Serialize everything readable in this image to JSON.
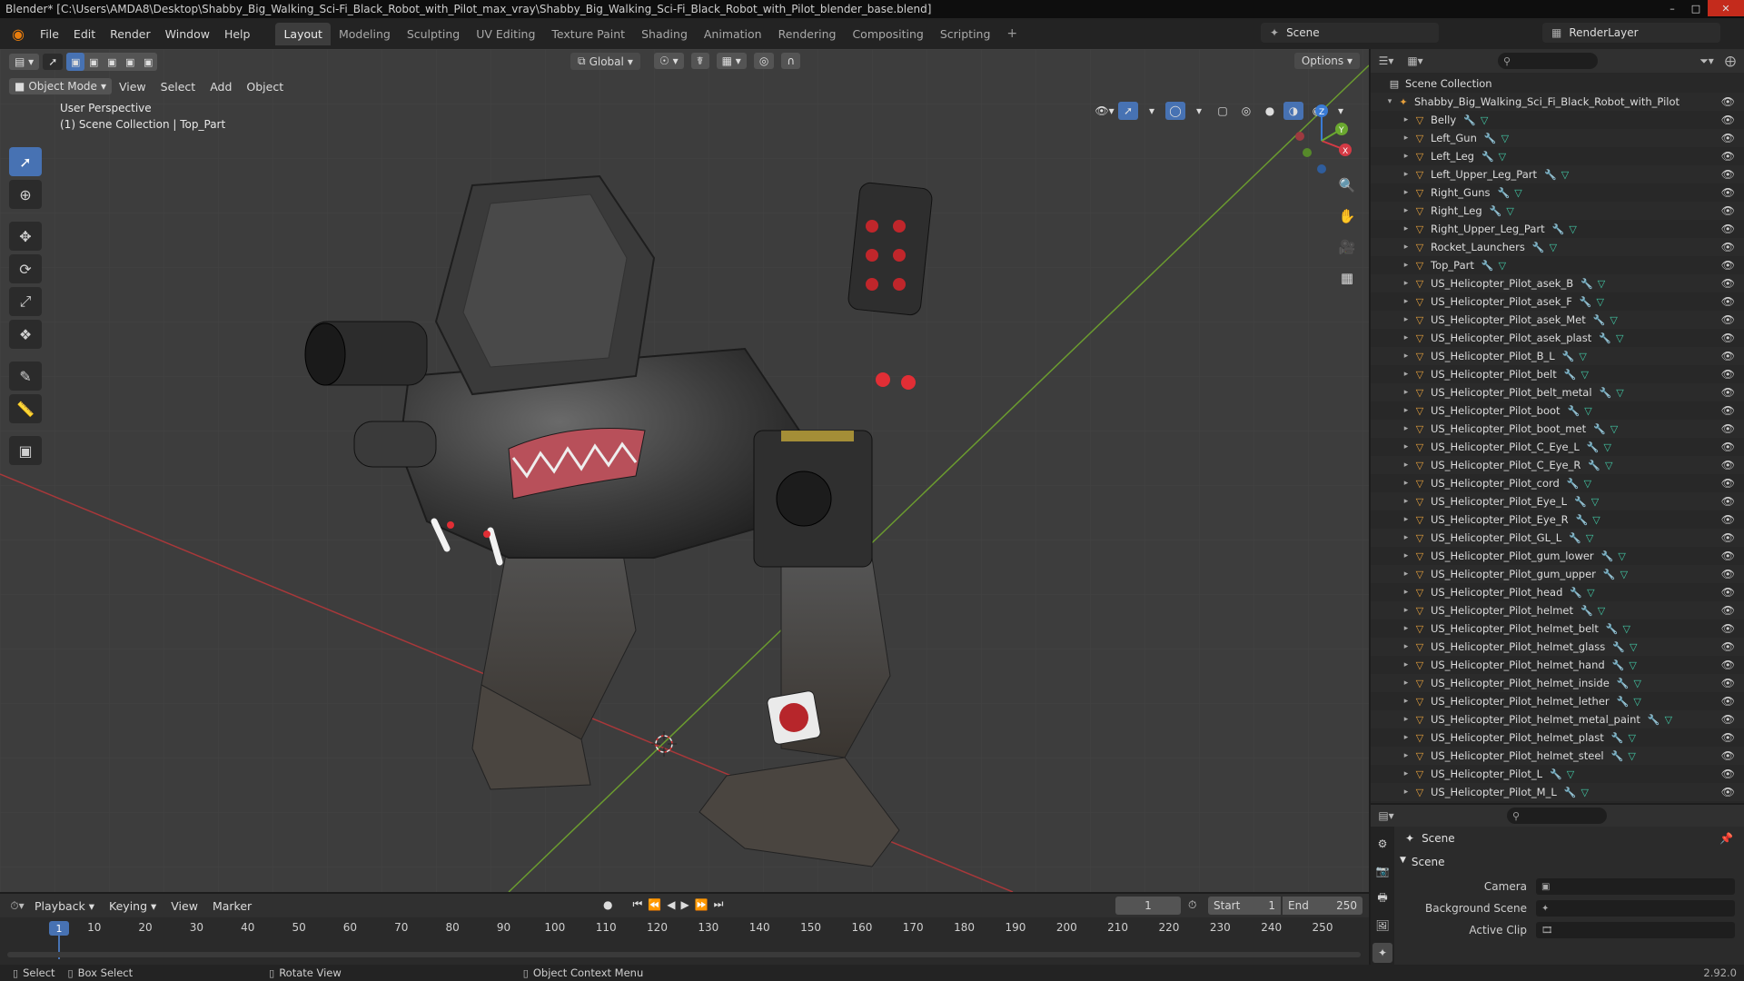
{
  "window": {
    "title": "Blender* [C:\\Users\\AMDA8\\Desktop\\Shabby_Big_Walking_Sci-Fi_Black_Robot_with_Pilot_max_vray\\Shabby_Big_Walking_Sci-Fi_Black_Robot_with_Pilot_blender_base.blend]"
  },
  "menu": [
    "File",
    "Edit",
    "Render",
    "Window",
    "Help"
  ],
  "workspaces": [
    "Layout",
    "Modeling",
    "Sculpting",
    "UV Editing",
    "Texture Paint",
    "Shading",
    "Animation",
    "Rendering",
    "Compositing",
    "Scripting"
  ],
  "scene_name": "Scene",
  "render_layer": "RenderLayer",
  "viewport": {
    "mode": "Object Mode",
    "menus": [
      "View",
      "Select",
      "Add",
      "Object"
    ],
    "orientation": "Global",
    "options_label": "Options",
    "info_line1": "User Perspective",
    "info_line2": "(1) Scene Collection | Top_Part"
  },
  "outliner": {
    "root": "Scene Collection",
    "collection": "Shabby_Big_Walking_Sci_Fi_Black_Robot_with_Pilot",
    "items": [
      "Belly",
      "Left_Gun",
      "Left_Leg",
      "Left_Upper_Leg_Part",
      "Right_Guns",
      "Right_Leg",
      "Right_Upper_Leg_Part",
      "Rocket_Launchers",
      "Top_Part",
      "US_Helicopter_Pilot_asek_B",
      "US_Helicopter_Pilot_asek_F",
      "US_Helicopter_Pilot_asek_Met",
      "US_Helicopter_Pilot_asek_plast",
      "US_Helicopter_Pilot_B_L",
      "US_Helicopter_Pilot_belt",
      "US_Helicopter_Pilot_belt_metal",
      "US_Helicopter_Pilot_boot",
      "US_Helicopter_Pilot_boot_met",
      "US_Helicopter_Pilot_C_Eye_L",
      "US_Helicopter_Pilot_C_Eye_R",
      "US_Helicopter_Pilot_cord",
      "US_Helicopter_Pilot_Eye_L",
      "US_Helicopter_Pilot_Eye_R",
      "US_Helicopter_Pilot_GL_L",
      "US_Helicopter_Pilot_gum_lower",
      "US_Helicopter_Pilot_gum_upper",
      "US_Helicopter_Pilot_head",
      "US_Helicopter_Pilot_helmet",
      "US_Helicopter_Pilot_helmet_belt",
      "US_Helicopter_Pilot_helmet_glass",
      "US_Helicopter_Pilot_helmet_hand",
      "US_Helicopter_Pilot_helmet_inside",
      "US_Helicopter_Pilot_helmet_lether",
      "US_Helicopter_Pilot_helmet_metal_paint",
      "US_Helicopter_Pilot_helmet_plast",
      "US_Helicopter_Pilot_helmet_steel",
      "US_Helicopter_Pilot_L",
      "US_Helicopter_Pilot_M_L"
    ]
  },
  "properties": {
    "context": "Scene",
    "panel": "Scene",
    "camera_label": "Camera",
    "bg_scene_label": "Background Scene",
    "active_clip_label": "Active Clip"
  },
  "timeline": {
    "menus": [
      "Playback",
      "Keying",
      "View",
      "Marker"
    ],
    "current_frame": "1",
    "start_label": "Start",
    "start_value": "1",
    "end_label": "End",
    "end_value": "250",
    "ticks": [
      "10",
      "20",
      "30",
      "40",
      "50",
      "60",
      "70",
      "80",
      "90",
      "100",
      "110",
      "120",
      "130",
      "140",
      "150",
      "160",
      "170",
      "180",
      "190",
      "200",
      "210",
      "220",
      "230",
      "240",
      "250"
    ]
  },
  "status": {
    "select": "Select",
    "box_select": "Box Select",
    "rotate_view": "Rotate View",
    "context_menu": "Object Context Menu",
    "version": "2.92.0"
  }
}
